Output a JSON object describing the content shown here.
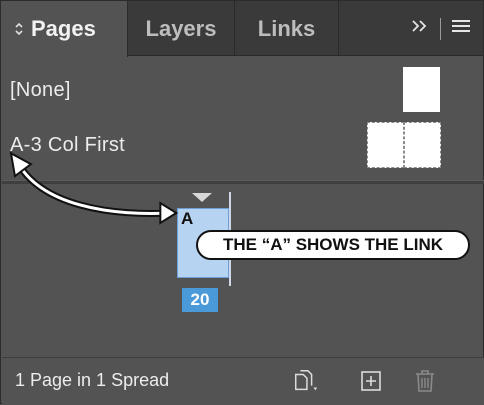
{
  "tabs": [
    {
      "label": "Pages",
      "active": true
    },
    {
      "label": "Layers",
      "active": false
    },
    {
      "label": "Links",
      "active": false
    }
  ],
  "tab_controls": {
    "overflow_icon": "double-chevron-right-icon",
    "menu_icon": "hamburger-menu-icon"
  },
  "masters": {
    "items": [
      {
        "label": "[None]",
        "thumbnail": "single-page"
      },
      {
        "label": "A-3 Col First",
        "thumbnail": "two-page-spread"
      }
    ]
  },
  "pages": {
    "page_number": "20",
    "master_prefix": "A",
    "selected_color": "#4a9ad9"
  },
  "annotation": {
    "callout_text": "THE “A” SHOWS THE LINK"
  },
  "footer": {
    "status": "1 Page in 1 Spread",
    "buttons": [
      "edit-page-size-icon",
      "new-page-icon",
      "delete-page-icon"
    ]
  }
}
